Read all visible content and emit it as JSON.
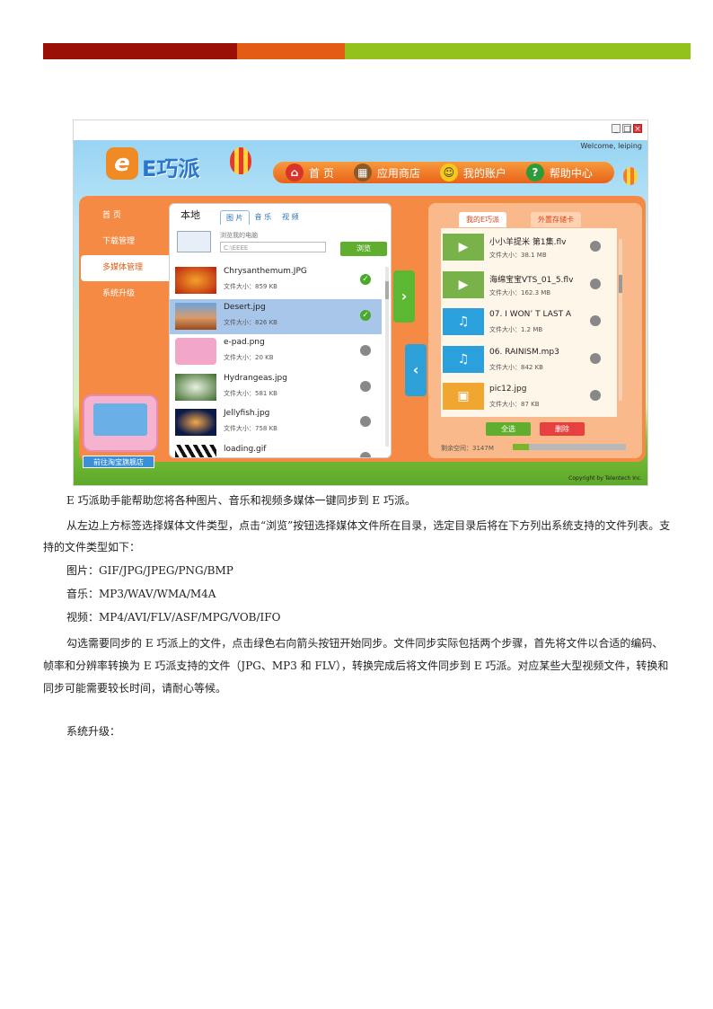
{
  "header_bar_colors": [
    "#9b1006",
    "#e35a12",
    "#93c21c"
  ],
  "app": {
    "window_controls": [
      "_",
      "□",
      "×"
    ],
    "welcome": "Welcome, leiping",
    "logo_text": "E巧派",
    "nav": [
      {
        "label": "首 页",
        "icon": "home-icon"
      },
      {
        "label": "应用商店",
        "icon": "store-icon"
      },
      {
        "label": "我的账户",
        "icon": "account-icon"
      },
      {
        "label": "帮助中心",
        "icon": "help-icon"
      }
    ],
    "side_menu": [
      {
        "label": "首 页",
        "active": false
      },
      {
        "label": "下载管理",
        "active": false
      },
      {
        "label": "多媒体管理",
        "active": true
      },
      {
        "label": "系统升级",
        "active": false
      }
    ],
    "shop_button": "前往淘宝旗舰店",
    "local": {
      "title": "本地",
      "tabs": [
        "图 片",
        "音 乐",
        "视 频"
      ],
      "browse_label": "浏览我的电脑",
      "path_placeholder": "C:\\EEEE",
      "browse_button": "浏览",
      "files": [
        {
          "name": "Chrysanthemum.JPG",
          "size": "文件大小：859 KB",
          "checked": true,
          "selected": false
        },
        {
          "name": "Desert.jpg",
          "size": "文件大小：826 KB",
          "checked": true,
          "selected": true
        },
        {
          "name": "e-pad.png",
          "size": "文件大小：20 KB",
          "checked": false,
          "selected": false
        },
        {
          "name": "Hydrangeas.jpg",
          "size": "文件大小：581 KB",
          "checked": false,
          "selected": false
        },
        {
          "name": "Jellyfish.jpg",
          "size": "文件大小：758 KB",
          "checked": false,
          "selected": false
        },
        {
          "name": "loading.gif",
          "size": "",
          "checked": false,
          "selected": false
        }
      ]
    },
    "device": {
      "tabs": [
        "我的E巧派",
        "外置存储卡"
      ],
      "files": [
        {
          "name": "小小羊提米 第1集.flv",
          "size": "文件大小：38.1 MB",
          "type": "video"
        },
        {
          "name": "海绵宝宝VTS_01_5.flv",
          "size": "文件大小：162.3 MB",
          "type": "video"
        },
        {
          "name": "07. I WON’ T LAST A",
          "size": "文件大小：1.2 MB",
          "type": "music"
        },
        {
          "name": "06. RAINISM.mp3",
          "size": "文件大小：842 KB",
          "type": "music"
        },
        {
          "name": "pic12.jpg",
          "size": "文件大小：87 KB",
          "type": "image"
        }
      ],
      "select_all": "全选",
      "delete": "删除",
      "remaining": "剩余空间：3147M",
      "storage_used_fraction": 0.14
    },
    "copyright": "Copyright by Telentech Inc."
  },
  "text": {
    "p1": "E 巧派助手能帮助您将各种图片、音乐和视频多媒体一键同步到 E 巧派。",
    "p2": "从左边上方标签选择媒体文件类型，点击“浏览”按钮选择媒体文件所在目录，选定目录后将在下方列出系统支持的文件列表。支持的文件类型如下：",
    "p3": "图片：GIF/JPG/JPEG/PNG/BMP",
    "p4": "音乐：MP3/WAV/WMA/M4A",
    "p5": "视频：MP4/AVI/FLV/ASF/MPG/VOB/IFO",
    "p6": "勾选需要同步的 E 巧派上的文件，点击绿色右向箭头按钮开始同步。文件同步实际包括两个步骤，首先将文件以合适的编码、帧率和分辨率转换为 E 巧派支持的文件（JPG、MP3 和 FLV），转换完成后将文件同步到 E 巧派。对应某些大型视频文件，转换和同步可能需要较长时间，请耐心等候。",
    "p7": "系统升级："
  }
}
